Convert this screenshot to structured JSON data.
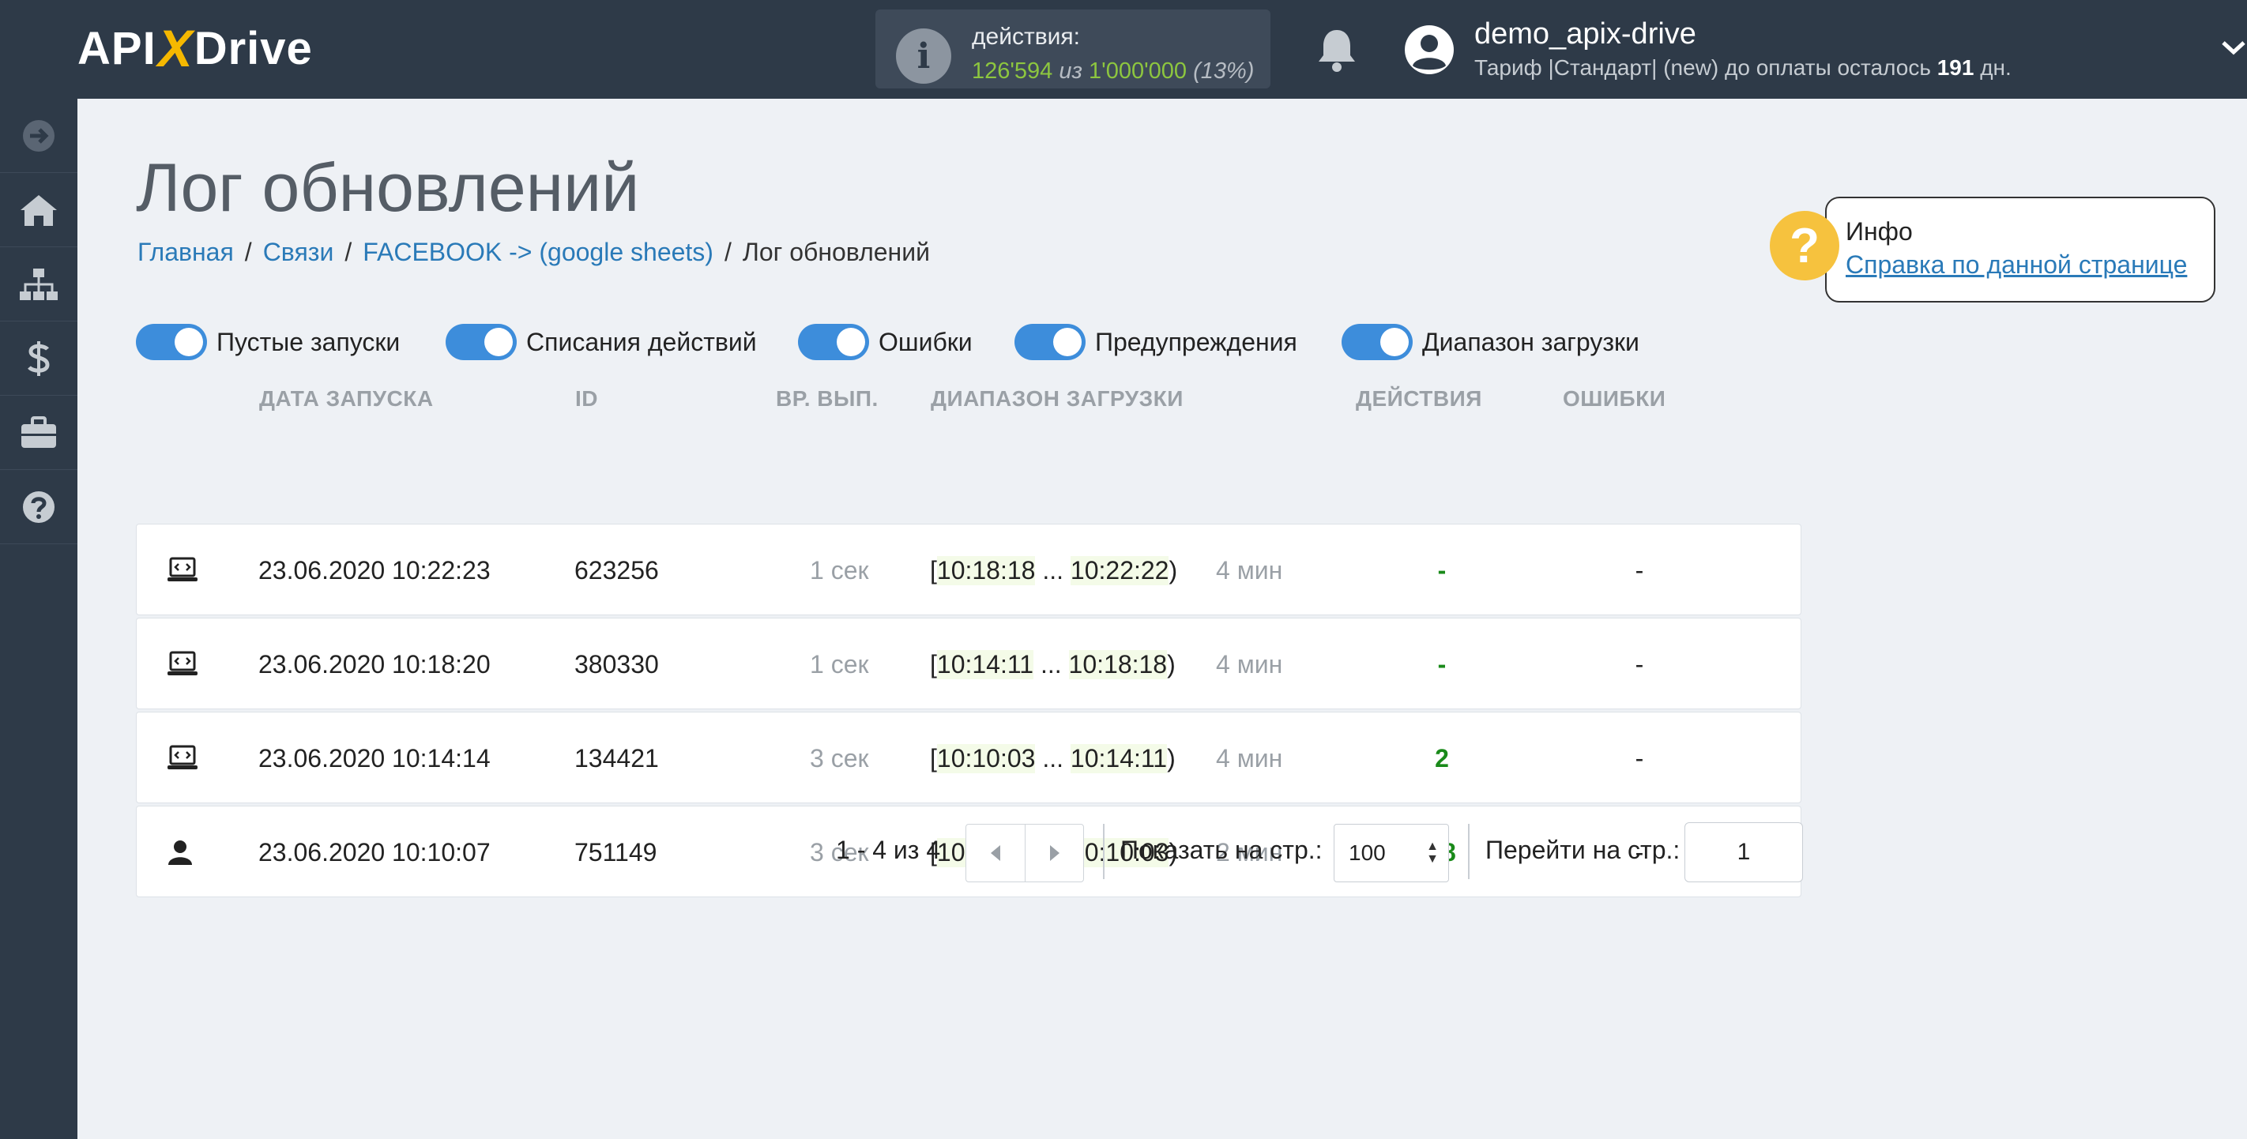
{
  "header": {
    "logo": {
      "part1": "API",
      "part2": "X",
      "part3": "Drive"
    },
    "actions": {
      "label": "действия:",
      "used": "126'594",
      "of_word": "из",
      "total": "1'000'000",
      "percent": "(13%)"
    },
    "user": {
      "name": "demo_apix-drive",
      "plan_prefix": "Тариф |Стандарт| (new) до оплаты осталось",
      "days": "191",
      "days_suffix": "дн."
    },
    "icons": [
      "info-icon",
      "bell-icon",
      "user-avatar-icon",
      "chevron-down-icon"
    ]
  },
  "sidebar": {
    "items": [
      {
        "name": "arrow-right-circle-icon"
      },
      {
        "name": "home-icon"
      },
      {
        "name": "sitemap-icon"
      },
      {
        "name": "dollar-icon"
      },
      {
        "name": "briefcase-icon"
      },
      {
        "name": "help-circle-icon"
      }
    ]
  },
  "page": {
    "title": "Лог обновлений",
    "breadcrumb": [
      "Главная",
      "Связи",
      "FACEBOOK -> (google sheets)",
      "Лог обновлений"
    ]
  },
  "info": {
    "title": "Инфо",
    "link": "Справка по данной странице"
  },
  "toggles": [
    {
      "label": "Пустые запуски",
      "on": true
    },
    {
      "label": "Списания действий",
      "on": true
    },
    {
      "label": "Ошибки",
      "on": true
    },
    {
      "label": "Предупреждения",
      "on": true
    },
    {
      "label": "Диапазон загрузки",
      "on": true
    }
  ],
  "table": {
    "columns": [
      "ДАТА ЗАПУСКА",
      "ID",
      "ВР. ВЫП.",
      "ДИАПАЗОН ЗАГРУЗКИ",
      "ДЕЙСТВИЯ",
      "ОШИБКИ"
    ],
    "rows": [
      {
        "icon": "laptop-code-icon",
        "date": "23.06.2020 10:22:23",
        "id": "623256",
        "duration": "1 сек",
        "range_open": "[",
        "range_start": "10:18:18",
        "range_mid": " ... ",
        "range_end": "10:22:22",
        "range_close": ")",
        "range_len": "4 мин",
        "actions": "-",
        "errors": "-"
      },
      {
        "icon": "laptop-code-icon",
        "date": "23.06.2020 10:18:20",
        "id": "380330",
        "duration": "1 сек",
        "range_open": "[",
        "range_start": "10:14:11",
        "range_mid": " ... ",
        "range_end": "10:18:18",
        "range_close": ")",
        "range_len": "4 мин",
        "actions": "-",
        "errors": "-"
      },
      {
        "icon": "laptop-code-icon",
        "date": "23.06.2020 10:14:14",
        "id": "134421",
        "duration": "3 сек",
        "range_open": "[",
        "range_start": "10:10:03",
        "range_mid": " ... ",
        "range_end": "10:14:11",
        "range_close": ")",
        "range_len": "4 мин",
        "actions": "2",
        "errors": "-"
      },
      {
        "icon": "user-icon",
        "date": "23.06.2020 10:10:07",
        "id": "751149",
        "duration": "3 сек",
        "range_open": "[",
        "range_start": "10:08:27",
        "range_mid": " ... ",
        "range_end": "10:10:03",
        "range_close": ")",
        "range_len": "2 мин",
        "actions": "48",
        "errors": "-"
      }
    ]
  },
  "pagination": {
    "summary": "1 - 4 из 4",
    "per_page_label": "Показать на стр.:",
    "per_page_value": "100",
    "goto_label": "Перейти на стр.:",
    "goto_value": "1"
  },
  "colors": {
    "topbar": "#2e3a48",
    "accent_blue": "#3d8ddb",
    "link": "#2a7ab8",
    "green": "#1a8a1a",
    "info_yellow": "#f6c23e"
  }
}
